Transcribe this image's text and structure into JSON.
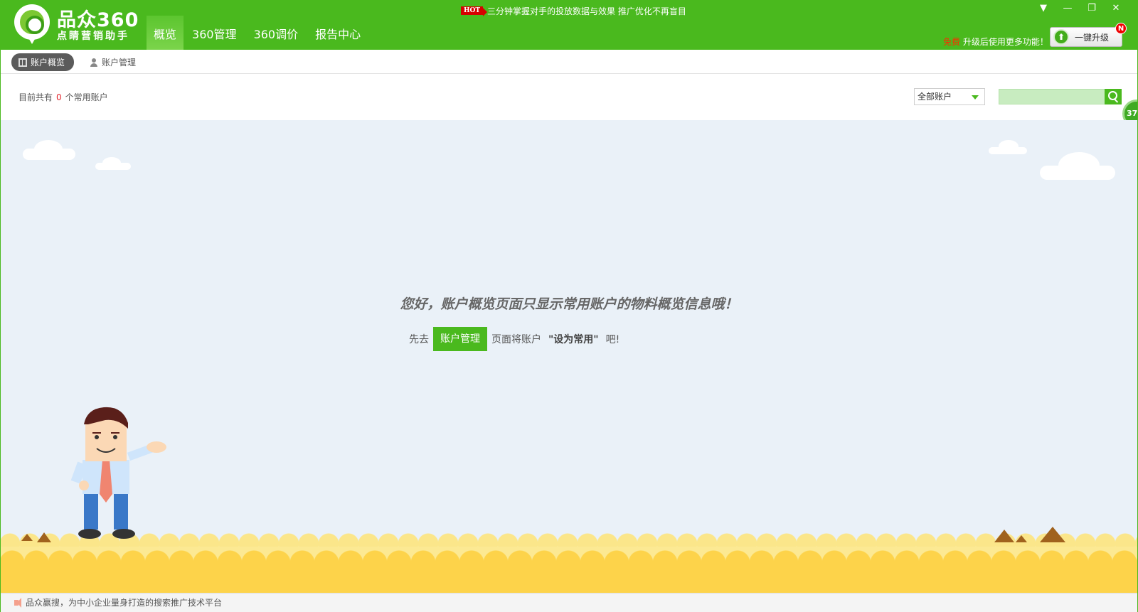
{
  "app": {
    "logo_title": "品众360",
    "logo_subtitle": "点睛营销助手"
  },
  "nav": {
    "tabs": [
      {
        "label": "概览",
        "active": true
      },
      {
        "label": "360管理",
        "active": false
      },
      {
        "label": "360调价",
        "active": false
      },
      {
        "label": "报告中心",
        "active": false
      }
    ]
  },
  "promo": {
    "hot_badge": "HOT",
    "text": "三分钟掌握对手的投放数据与效果  推广优化不再盲目"
  },
  "window_controls": {
    "menu": "▼",
    "minimize": "—",
    "restore": "❐",
    "close": "✕"
  },
  "upgrade": {
    "free_label": "免费",
    "note": "升级后使用更多功能！",
    "button_icon": "⬆",
    "button_label": "一键升级",
    "new_badge": "N"
  },
  "subtabs": [
    {
      "label": "账户概览",
      "active": true
    },
    {
      "label": "账户管理",
      "active": false
    }
  ],
  "info": {
    "prefix": "目前共有",
    "count": "0",
    "suffix": "个常用账户",
    "filter_value": "全部账户",
    "search_value": "",
    "float_badge": "37"
  },
  "message": {
    "title": "您好，账户概览页面只显示常用账户的物料概览信息哦！",
    "pre": "先去",
    "button": "账户管理",
    "mid": "页面将账户",
    "strong": "\"设为常用\"",
    "post": "吧!"
  },
  "status": {
    "text": "品众赢搜，为中小企业量身打造的搜索推广技术平台"
  },
  "colors": {
    "brand_green": "#4ab91e",
    "count_red": "#e3262d",
    "free_red": "#ff2a00",
    "background_blue": "#eaf1f8",
    "ground_yellow": "#fdd34a"
  }
}
